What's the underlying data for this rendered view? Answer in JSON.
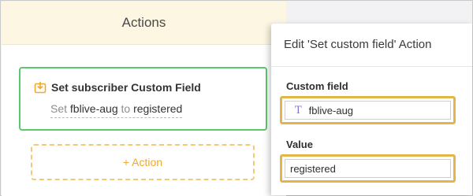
{
  "actions_panel": {
    "header": "Actions",
    "card": {
      "title": "Set subscriber Custom Field",
      "sub_prefix": "Set",
      "field_name": "fblive-aug",
      "connector": "to",
      "value": "registered",
      "icon": "download-icon"
    },
    "add_action_label": "+ Action"
  },
  "edit_panel": {
    "title": "Edit 'Set custom field' Action",
    "custom_field_label": "Custom field",
    "custom_field_value": "fblive-aug",
    "custom_field_icon": "text-type-icon",
    "value_label": "Value",
    "value_value": "registered"
  },
  "colors": {
    "header_bg": "#fdf6e3",
    "card_border": "#5cc86e",
    "add_action": "#f0a92c",
    "highlight": "#e4b548",
    "text_icon": "#8a72c9"
  }
}
